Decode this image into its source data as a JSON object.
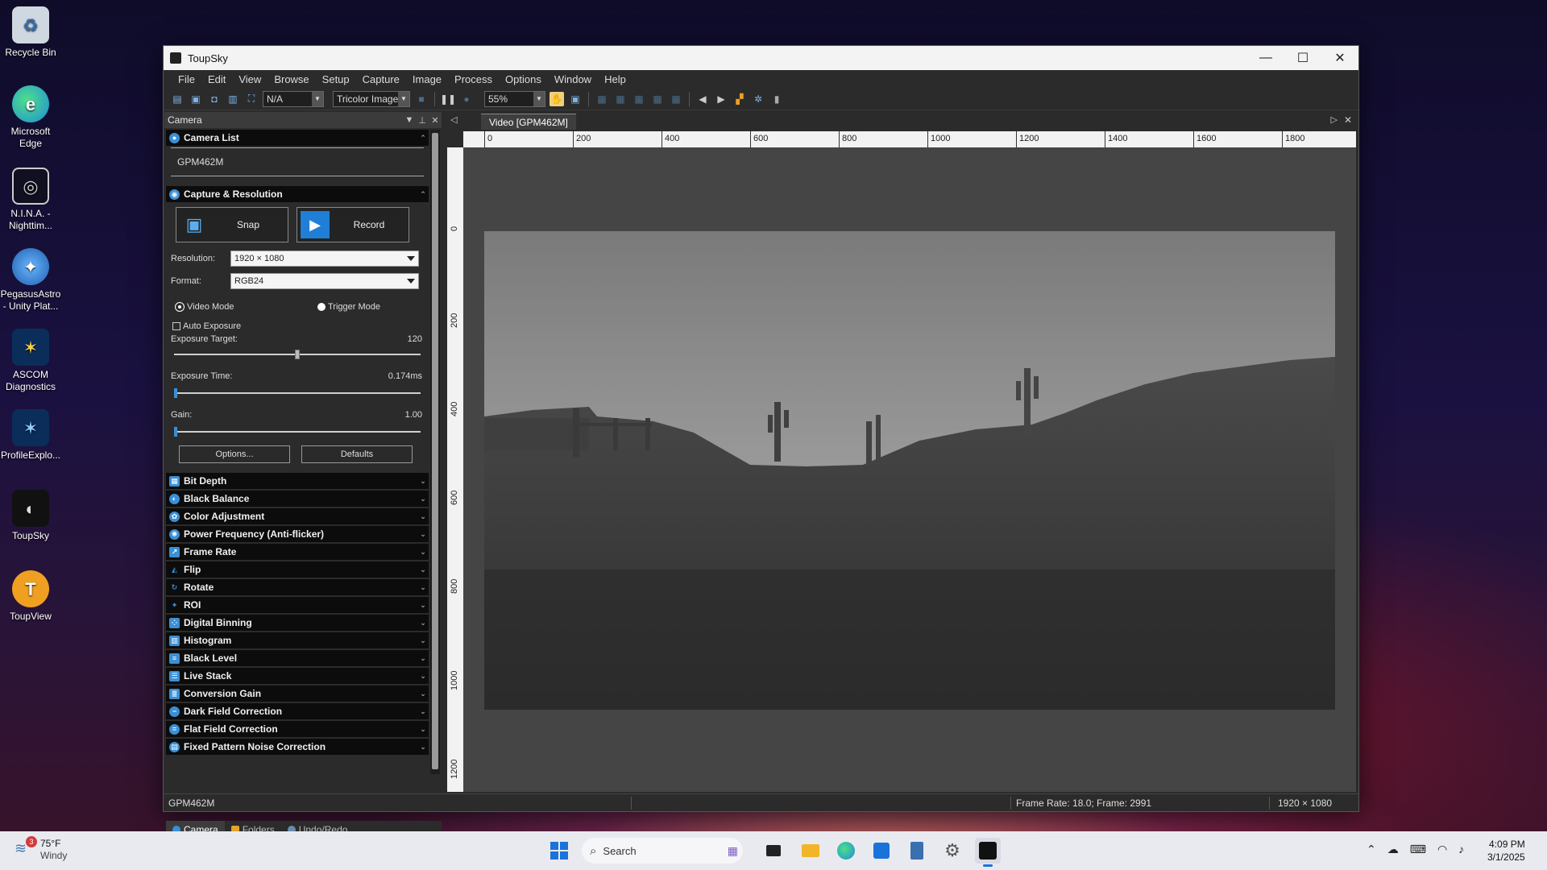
{
  "desktop": {
    "icons": [
      {
        "label": "Recycle Bin",
        "icon": "recycle-bin-icon"
      },
      {
        "label": "Microsoft Edge",
        "icon": "edge-icon"
      },
      {
        "label": "N.I.N.A. - Nighttim...",
        "icon": "nina-icon"
      },
      {
        "label": "PegasusAstro - Unity Plat...",
        "icon": "pegasus-icon"
      },
      {
        "label": "ASCOM Diagnostics",
        "icon": "ascom-icon"
      },
      {
        "label": "ProfileExplo...",
        "icon": "ascom-profile-icon"
      },
      {
        "label": "ToupSky",
        "icon": "toupsky-icon"
      },
      {
        "label": "ToupView",
        "icon": "toupview-icon"
      }
    ]
  },
  "window": {
    "title": "ToupSky",
    "menu": [
      "File",
      "Edit",
      "View",
      "Browse",
      "Setup",
      "Capture",
      "Image",
      "Process",
      "Options",
      "Window",
      "Help"
    ],
    "toolbar": {
      "combo1": "N/A",
      "combo2": "Tricolor Image",
      "zoom": "55%"
    }
  },
  "camera_panel": {
    "title": "Camera",
    "camera_list_title": "Camera List",
    "camera_name": "GPM462M",
    "capture_title": "Capture & Resolution",
    "snap_label": "Snap",
    "record_label": "Record",
    "resolution_label": "Resolution:",
    "resolution_value": "1920 × 1080",
    "format_label": "Format:",
    "format_value": "RGB24",
    "video_mode": "Video Mode",
    "trigger_mode": "Trigger Mode",
    "auto_exposure": "Auto Exposure",
    "exposure_target_label": "Exposure Target:",
    "exposure_target_value": "120",
    "exposure_target_fraction": 0.5,
    "exposure_time_label": "Exposure Time:",
    "exposure_time_value": "0.174ms",
    "gain_label": "Gain:",
    "gain_value": "1.00",
    "options_label": "Options...",
    "defaults_label": "Defaults",
    "sections": [
      "Bit Depth",
      "Black Balance",
      "Color Adjustment",
      "Power Frequency (Anti-flicker)",
      "Frame Rate",
      "Flip",
      "Rotate",
      "ROI",
      "Digital Binning",
      "Histogram",
      "Black Level",
      "Live Stack",
      "Conversion Gain",
      "Dark Field Correction",
      "Flat Field Correction",
      "Fixed Pattern Noise Correction"
    ],
    "bottom_tabs": [
      "Camera",
      "Folders",
      "Undo/Redo"
    ]
  },
  "video": {
    "tab_label": "Video [GPM462M]",
    "h_ticks": [
      "0",
      "200",
      "400",
      "600",
      "800",
      "1000",
      "1200",
      "1400",
      "1600",
      "1800"
    ],
    "v_ticks": [
      "0",
      "200",
      "400",
      "600",
      "800",
      "1000",
      "1200"
    ]
  },
  "status": {
    "camera": "GPM462M",
    "frame_info": "Frame Rate: 18.0; Frame: 2991",
    "resolution": "1920 × 1080"
  },
  "taskbar": {
    "weather_temp": "75°F",
    "weather_desc": "Windy",
    "weather_badge": "3",
    "search_placeholder": "Search",
    "time": "4:09 PM",
    "date": "3/1/2025"
  },
  "colors": {
    "accent": "#3a8fd6",
    "section_bg": "#0c0c0c",
    "panel_bg": "#2b2b2b"
  }
}
